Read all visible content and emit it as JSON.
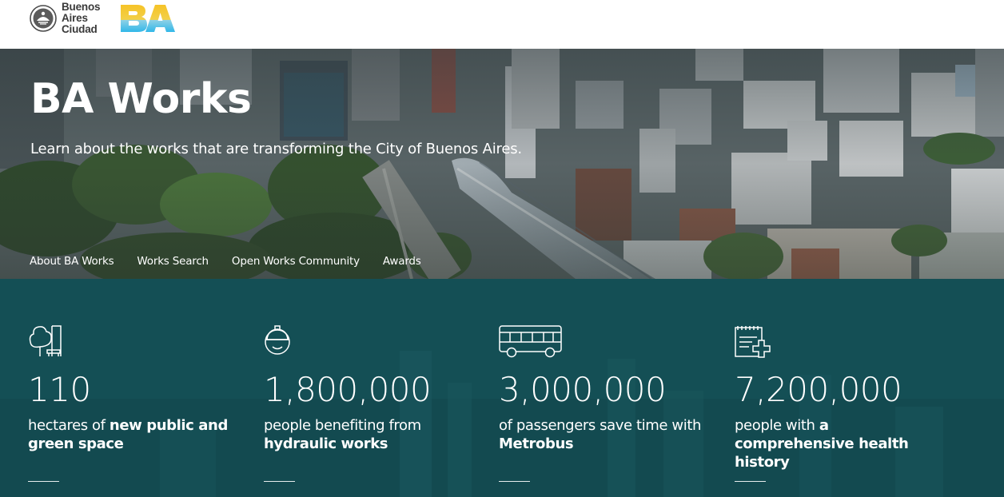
{
  "header": {
    "city_name_lines": [
      "Buenos",
      "Aires",
      "Ciudad"
    ],
    "brand_logo": "BA",
    "colors": {
      "logo_yellow": "#f6c327",
      "logo_blue": "#31b7e8",
      "text": "#3a3a3a"
    }
  },
  "hero": {
    "title": "BA Works",
    "subtitle": "Learn about the works that are transforming the City of Buenos Aires.",
    "nav": [
      {
        "label": "About BA Works"
      },
      {
        "label": "Works Search"
      },
      {
        "label": "Open Works Community"
      },
      {
        "label": "Awards"
      }
    ]
  },
  "stats": {
    "background_color": "#144f55",
    "items": [
      {
        "icon": "tree-bench-icon",
        "value": "110",
        "desc_plain": "hectares of ",
        "desc_bold": "new public and green space",
        "desc_plain_after": ""
      },
      {
        "icon": "hard-hat-icon",
        "value": "1,800,000",
        "desc_plain": "people benefiting from ",
        "desc_bold": "hydraulic works",
        "desc_plain_after": ""
      },
      {
        "icon": "bus-icon",
        "value": "3,000,000",
        "desc_plain": "of passengers save time with ",
        "desc_bold": "Metrobus",
        "desc_plain_after": ""
      },
      {
        "icon": "health-record-icon",
        "value": "7,200,000",
        "desc_plain": "people with ",
        "desc_bold": "a comprehensive health history",
        "desc_plain_after": ""
      }
    ]
  }
}
